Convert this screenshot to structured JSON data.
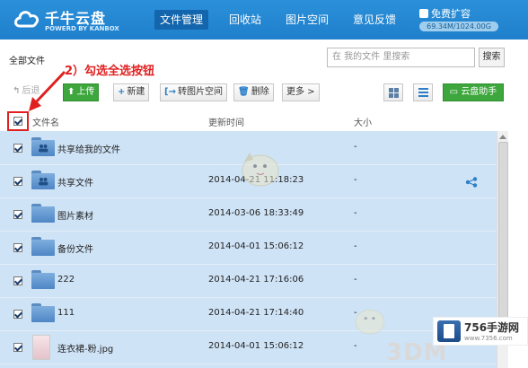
{
  "app": {
    "name": "千牛云盘",
    "tagline": "POWERD BY KANBOX"
  },
  "nav": {
    "items": [
      "文件管理",
      "回收站",
      "图片空间",
      "意见反馈"
    ],
    "active": "文件管理"
  },
  "account": {
    "upgrade_label": "免费扩容",
    "quota": "69.34M/1024.00G"
  },
  "breadcrumb": "全部文件",
  "search": {
    "placeholder": "在 我的文件 里搜索",
    "button": "搜索"
  },
  "toolbar": {
    "back": "后退",
    "upload": "上传",
    "new": "新建",
    "to_image_space": "转图片空间",
    "delete": "删除",
    "more": "更多 >",
    "assistant": "云盘助手"
  },
  "table": {
    "headers": [
      "文件名",
      "更新时间",
      "大小"
    ],
    "rows": [
      {
        "name": "共享给我的文件",
        "time": "",
        "size": "-",
        "type": "shared-folder",
        "checked": true
      },
      {
        "name": "共享文件",
        "time": "2014-04-21 11:18:23",
        "size": "-",
        "type": "shared-folder",
        "checked": true
      },
      {
        "name": "图片素材",
        "time": "2014-03-06 18:33:49",
        "size": "-",
        "type": "folder",
        "checked": true
      },
      {
        "name": "备份文件",
        "time": "2014-04-01 15:06:12",
        "size": "-",
        "type": "folder",
        "checked": true
      },
      {
        "name": "222",
        "time": "2014-04-21 17:16:06",
        "size": "-",
        "type": "folder",
        "checked": true
      },
      {
        "name": "111",
        "time": "2014-04-21 17:14:40",
        "size": "-",
        "type": "folder",
        "checked": true
      },
      {
        "name": "连衣裙-粉.jpg",
        "time": "2014-04-01 15:06:12",
        "size": "-",
        "type": "image",
        "checked": true
      }
    ]
  },
  "annotation": "2）勾选全选按钮",
  "watermark": {
    "site": "756手游网",
    "url": "www.7356.com",
    "brand": "3DM"
  },
  "colors": {
    "header": "#2b90d9",
    "selected_row": "#cfe3f6",
    "green": "#3da63d",
    "annotation": "#e02020"
  }
}
